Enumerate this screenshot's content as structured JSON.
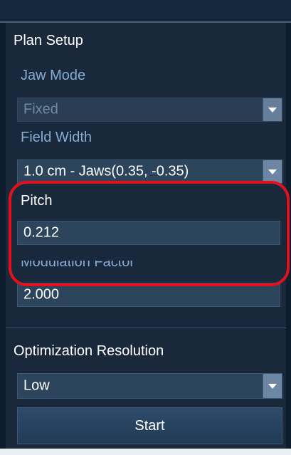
{
  "plan_setup": {
    "title": "Plan Setup",
    "jaw_mode": {
      "label": "Jaw Mode",
      "value": "Fixed",
      "dropdown_icon": "chevron-down-icon"
    },
    "field_width": {
      "label": "Field Width",
      "value": "1.0 cm - Jaws(0.35, -0.35)",
      "dropdown_icon": "chevron-down-icon"
    },
    "pitch": {
      "label": "Pitch",
      "value": "0.212"
    },
    "modulation_factor": {
      "label": "Modulation Factor",
      "value": "2.000"
    }
  },
  "optimization": {
    "title": "Optimization Resolution",
    "resolution": {
      "value": "Low",
      "dropdown_icon": "chevron-down-icon"
    },
    "start_label": "Start"
  },
  "colors": {
    "background": "#19293b",
    "label_blue": "#86acd6",
    "field_bg": "#2c445c",
    "highlight_red": "#e3101e"
  }
}
